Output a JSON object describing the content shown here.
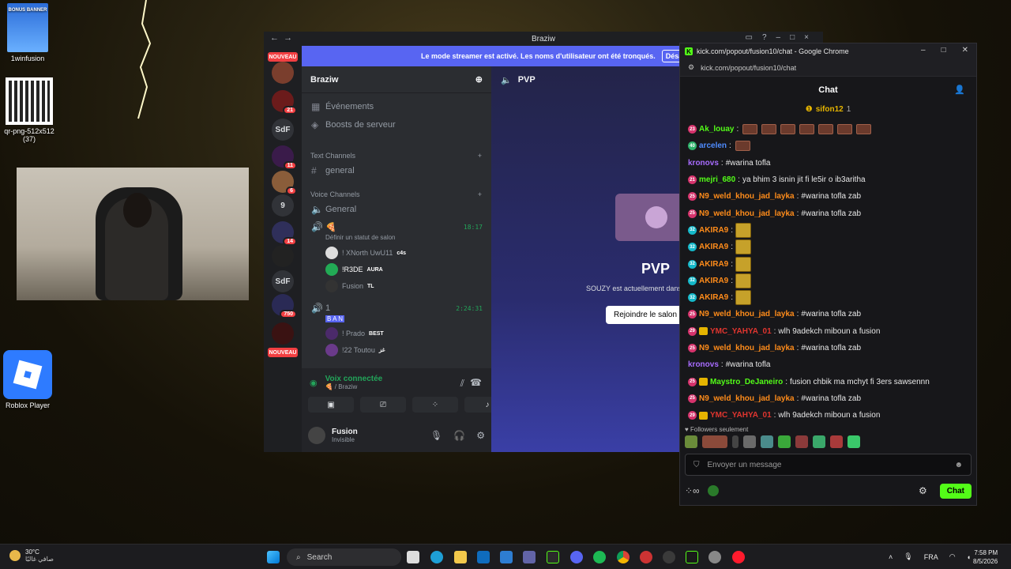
{
  "desktop": {
    "icons": [
      {
        "label": "1winfusion",
        "banner": "BONUS BANNER"
      },
      {
        "label": "qr-png-512x512 (37)"
      },
      {
        "label": "Roblox Player"
      }
    ]
  },
  "discord": {
    "window_title": "Braziw",
    "streamer_notice": "Le mode streamer est activé. Les noms d'utilisateur ont été tronqués.",
    "streamer_button": "Désactiv",
    "guilds": {
      "new_label": "NOUVEAU",
      "badge_21": "21",
      "sdf": "SdF",
      "badge_11": "11",
      "badge_6": "6",
      "nine": "9",
      "badge_14": "14",
      "sdf2": "SdF",
      "badge_750": "750"
    },
    "server_name": "Braziw",
    "links": [
      "Événements",
      "Boosts de serveur"
    ],
    "text_category": "Text Channels",
    "text_channel": "general",
    "voice_category": "Voice Channels",
    "voice_channel_general": "General",
    "voice_channel_1": {
      "name": "🍕",
      "status": "Définir un statut de salon",
      "timer": "18:17"
    },
    "voice_users_1": [
      {
        "name": "! XNorth UwU11",
        "tag": "c4s"
      },
      {
        "name": "!R3DE",
        "tag": "AURA"
      },
      {
        "name": "Fusion",
        "tag": "TL"
      }
    ],
    "voice_channel_2": {
      "name": "1",
      "ban": "B A N",
      "timer": "2:24:31"
    },
    "voice_users_2": [
      {
        "name": "! Prado",
        "tag": "BEST"
      },
      {
        "name": "!22 Toutou",
        "tag": "غز"
      }
    ],
    "voice_connected": "Voix connectée",
    "voice_location": "🍕 / Braziw",
    "user_name": "Fusion",
    "user_status": "Invisible",
    "main_channel": "PVP",
    "main_title": "PVP",
    "main_sub": "SOUZY est actuellement dans",
    "join_button": "Rejoindre le salon"
  },
  "chrome": {
    "title": "kick.com/popout/fusion10/chat - Google Chrome",
    "url": "kick.com/popout/fusion10/chat",
    "chat_title": "Chat",
    "pinned_user": "sifon12",
    "pinned_count": "1",
    "messages": [
      {
        "lvl": "23",
        "lvlColor": "#d6336c",
        "user": "Ak_louay",
        "color": "#53fc18",
        "text": "",
        "emotes": 7
      },
      {
        "lvl": "40",
        "lvlColor": "#2fb36b",
        "user": "arcelen",
        "color": "#4f8cff",
        "text": "",
        "emotes": 1
      },
      {
        "lvl": "",
        "lvlColor": "",
        "user": "kronovs",
        "color": "#a86cff",
        "text": "#warina tofla",
        "emotes": 0
      },
      {
        "lvl": "21",
        "lvlColor": "#d6336c",
        "user": "mejri_680",
        "color": "#53fc18",
        "text": "ya bhim 3 isnin jit fi le5ir o ib3aritha",
        "emotes": 0
      },
      {
        "lvl": "25",
        "lvlColor": "#d6336c",
        "user": "N9_weld_khou_jad_layka",
        "color": "#ff8c1a",
        "text": "#warina tofla zab",
        "emotes": 0
      },
      {
        "lvl": "25",
        "lvlColor": "#d6336c",
        "user": "N9_weld_khou_jad_layka",
        "color": "#ff8c1a",
        "text": "#warina tofla zab",
        "emotes": 0
      },
      {
        "lvl": "32",
        "lvlColor": "#15b8c9",
        "user": "AKIRA9",
        "color": "#ff8c1a",
        "text": "",
        "emotes": -1
      },
      {
        "lvl": "32",
        "lvlColor": "#15b8c9",
        "user": "AKIRA9",
        "color": "#ff8c1a",
        "text": "",
        "emotes": -1
      },
      {
        "lvl": "32",
        "lvlColor": "#15b8c9",
        "user": "AKIRA9",
        "color": "#ff8c1a",
        "text": "",
        "emotes": -1
      },
      {
        "lvl": "32",
        "lvlColor": "#15b8c9",
        "user": "AKIRA9",
        "color": "#ff8c1a",
        "text": "",
        "emotes": -1
      },
      {
        "lvl": "32",
        "lvlColor": "#15b8c9",
        "user": "AKIRA9",
        "color": "#ff8c1a",
        "text": "",
        "emotes": -1
      },
      {
        "lvl": "25",
        "lvlColor": "#d6336c",
        "user": "N9_weld_khou_jad_layka",
        "color": "#ff8c1a",
        "text": "#warina tofla zab",
        "emotes": 0
      },
      {
        "lvl": "29",
        "lvlColor": "#d6336c",
        "crown": true,
        "user": "YMC_YAHYA_01",
        "color": "#e0352f",
        "text": "wlh 9adekch miboun a fusion",
        "emotes": 0
      },
      {
        "lvl": "25",
        "lvlColor": "#d6336c",
        "user": "N9_weld_khou_jad_layka",
        "color": "#ff8c1a",
        "text": "#warina tofla zab",
        "emotes": 0
      },
      {
        "lvl": "",
        "lvlColor": "",
        "user": "kronovs",
        "color": "#a86cff",
        "text": "#warina tofla",
        "emotes": 0
      },
      {
        "lvl": "25",
        "lvlColor": "#d6336c",
        "crown": true,
        "user": "Maystro_DeJaneiro",
        "color": "#53fc18",
        "text": "fusion chbik ma mchyt fi 3ers sawsennn",
        "emotes": 0
      },
      {
        "lvl": "25",
        "lvlColor": "#d6336c",
        "user": "N9_weld_khou_jad_layka",
        "color": "#ff8c1a",
        "text": "#warina tofla zab",
        "emotes": 0
      },
      {
        "lvl": "29",
        "lvlColor": "#d6336c",
        "crown": true,
        "user": "YMC_YAHYA_01",
        "color": "#e0352f",
        "text": "wlh 9adekch miboun a fusion",
        "emotes": 0
      }
    ],
    "followers_only": "Followers seulement",
    "input_placeholder": "Envoyer un message",
    "chat_button": "Chat"
  },
  "taskbar": {
    "weather_temp": "30°C",
    "weather_desc": "صافي غالبًا",
    "search": "Search",
    "lang": "FRA",
    "time": "7:58 PM",
    "date": "8/5/2026"
  }
}
